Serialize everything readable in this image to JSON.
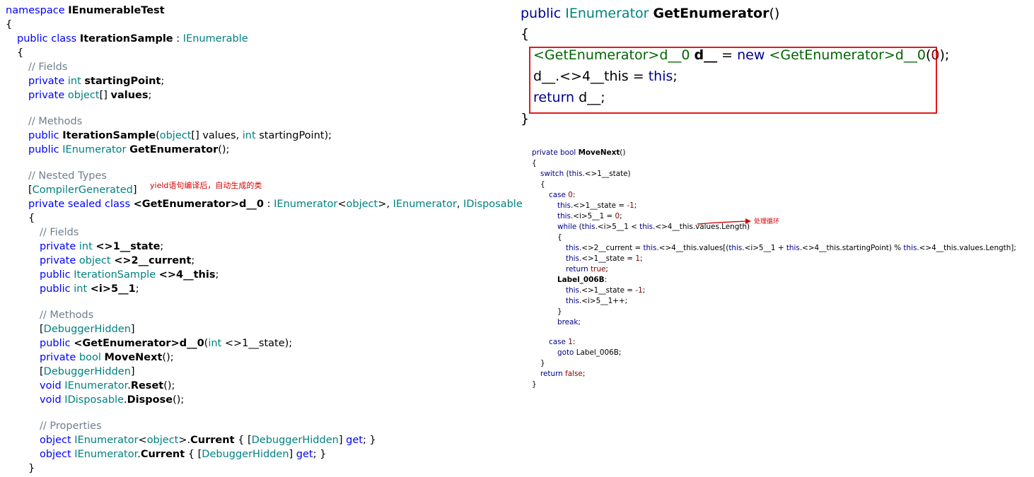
{
  "left_code": {
    "line1": {
      "kw": "namespace",
      "name": "IEnumerableTest"
    },
    "line2": "{",
    "line3": {
      "kw": "public class",
      "name": "IterationSample",
      "sep": " : ",
      "iface": "IEnumerable"
    },
    "line4": "{",
    "line5": "// Fields",
    "line6": {
      "kw": "private",
      "type": "int",
      "name": "startingPoint",
      "end": ";"
    },
    "line7": {
      "kw": "private",
      "type": "object",
      "arr": "[]",
      "name": "values",
      "end": ";"
    },
    "line8": "// Methods",
    "line9": {
      "kw": "public",
      "name": "IterationSample",
      "open": "(",
      "type1": "object",
      "p1": "[] values, ",
      "type2": "int",
      "p2": " startingPoint);"
    },
    "line10": {
      "kw": "public",
      "type": "IEnumerator",
      "name": "GetEnumerator",
      "end": "();"
    },
    "line11": "// Nested Types",
    "line12": {
      "open": "[",
      "attr": "CompilerGenerated",
      "close": "]"
    },
    "line13": {
      "kw": "private sealed class",
      "name": "<GetEnumerator>d__0",
      "sep": " : ",
      "t1": "IEnumerator",
      "lt": "<",
      "t2": "object",
      "gt": ">",
      "c1": ", ",
      "t3": "IEnumerator",
      "c2": ", ",
      "t4": "IDisposable"
    },
    "line14": "{",
    "line15": "// Fields",
    "line16": {
      "kw": "private",
      "type": "int",
      "name": "<>1__state",
      "end": ";"
    },
    "line17": {
      "kw": "private",
      "type": "object",
      "name": "<>2__current",
      "end": ";"
    },
    "line18": {
      "kw": "public",
      "type": "IterationSample",
      "name": "<>4__this",
      "end": ";"
    },
    "line19": {
      "kw": "public",
      "type": "int",
      "name": "<i>5__1",
      "end": ";"
    },
    "line20": "// Methods",
    "line21": {
      "open": "[",
      "attr": "DebuggerHidden",
      "close": "]"
    },
    "line22": {
      "kw": "public",
      "name": "<GetEnumerator>d__0",
      "open": "(",
      "type": "int",
      "rest": " <>1__state);"
    },
    "line23": {
      "kw": "private",
      "type": "bool",
      "name": "MoveNext",
      "end": "();"
    },
    "line24": {
      "open": "[",
      "attr": "DebuggerHidden",
      "close": "]"
    },
    "line25": {
      "kw": "void",
      "type": "IEnumerator",
      "dot": ".",
      "name": "Reset",
      "end": "();"
    },
    "line26": {
      "kw": "void",
      "type": "IDisposable",
      "dot": ".",
      "name": "Dispose",
      "end": "();"
    },
    "line27": "// Properties",
    "line28": {
      "kw": "object",
      "type": "IEnumerator",
      "lt": "<",
      "type2": "object",
      "gt": ">.",
      "name": "Current",
      "open": " { [",
      "attr": "DebuggerHidden",
      "close": "] ",
      "get": "get",
      "end": "; }"
    },
    "line29": {
      "kw": "object",
      "type": "IEnumerator",
      "dot": ".",
      "name": "Current",
      "open": " { [",
      "attr": "DebuggerHidden",
      "close": "] ",
      "get": "get",
      "end": "; }"
    },
    "line30": "}"
  },
  "annotation_yield": "yield语句编译后，自动生成的类",
  "annotation_loop": "处理循环",
  "get_enumerator": {
    "sig_kw": "public",
    "sig_type": "IEnumerator",
    "sig_name": "GetEnumerator",
    "sig_end": "()",
    "open": "{",
    "l1_type": "<GetEnumerator>d__0",
    "l1_var": "d__",
    "l1_eq": " = ",
    "l1_new": "new",
    "l1_type2": "<GetEnumerator>d__0",
    "l1_open": "(",
    "l1_num": "0",
    "l1_close": ");",
    "l2_var": "d__",
    "l2_field": ".<>4__this",
    "l2_eq": " = ",
    "l2_this": "this",
    "l2_end": ";",
    "l3_kw": "return",
    "l3_var": "d__",
    "l3_end": ";",
    "close": "}"
  },
  "move_next": {
    "l1_kw": "private",
    "l1_type": "bool",
    "l1_name": "MoveNext",
    "l1_end": "()",
    "l2": "{",
    "l3_kw": "switch",
    "l3_open": " (",
    "l3_this": "this",
    "l3_rest": ".<>1__state)",
    "l4": "{",
    "l5_kw": "case",
    "l5_num": "0",
    "l5_end": ":",
    "l6_this": "this",
    "l6_rest": ".<>1__state = ",
    "l6_num": "-1",
    "l6_end": ";",
    "l7_this": "this",
    "l7_rest": ".<i>5__1 = ",
    "l7_num": "0",
    "l7_end": ";",
    "l8_kw": "while",
    "l8_open": " (",
    "l8_this1": "this",
    "l8_mid": ".<i>5__1 < ",
    "l8_this2": "this",
    "l8_rest": ".<>4__this.values.Length)",
    "l9": "{",
    "l10_this1": "this",
    "l10_a": ".<>2__current = ",
    "l10_this2": "this",
    "l10_b": ".<>4__this.values[(",
    "l10_this3": "this",
    "l10_c": ".<i>5__1 + ",
    "l10_this4": "this",
    "l10_d": ".<>4__this.startingPoint) % ",
    "l10_this5": "this",
    "l10_e": ".<>4__this.values.Length];",
    "l11_this": "this",
    "l11_rest": ".<>1__state = ",
    "l11_num": "1",
    "l11_end": ";",
    "l12_kw": "return",
    "l12_val": "true",
    "l12_end": ";",
    "l13_label": "Label_006B",
    "l13_end": ":",
    "l14_this": "this",
    "l14_rest": ".<>1__state = ",
    "l14_num": "-1",
    "l14_end": ";",
    "l15_this": "this",
    "l15_rest": ".<i>5__1++;",
    "l16": "}",
    "l17_kw": "break",
    "l17_end": ";",
    "l18_kw": "case",
    "l18_num": "1",
    "l18_end": ":",
    "l19_kw": "goto",
    "l19_label": " Label_006B;",
    "l20": "}",
    "l21_kw": "return",
    "l21_val": "false",
    "l21_end": ";",
    "l22": "}"
  },
  "colors": {
    "keyword": "#0000ff",
    "type": "#008080",
    "comment": "#708090",
    "annotation": "#d40000",
    "highlight_box": "#e01919"
  }
}
